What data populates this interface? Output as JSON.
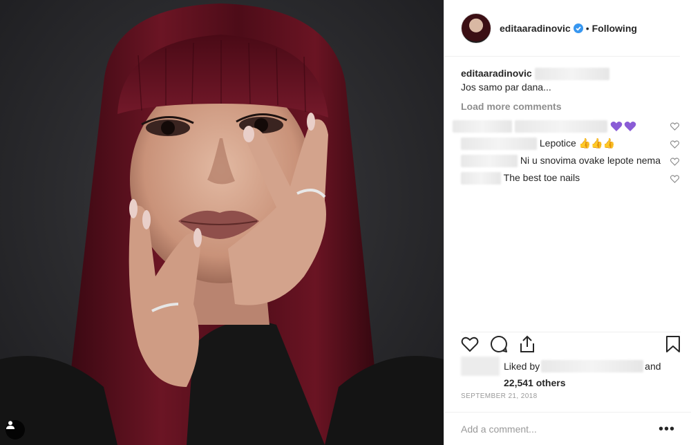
{
  "post": {
    "username": "editaaradinovic",
    "separator": "•",
    "follow_status": "Following"
  },
  "caption": {
    "username": "editaaradinovic",
    "text": "Jos samo par dana..."
  },
  "load_more": "Load more comments",
  "comments": [
    {
      "text": ""
    },
    {
      "text": "Lepotice 👍👍👍"
    },
    {
      "text": "Ni u snovima ovake lepote nema"
    },
    {
      "text": "The best toe nails"
    }
  ],
  "likes": {
    "prefix": "Liked by",
    "suffix": "and",
    "count": "22,541 others"
  },
  "date": "SEPTEMBER 21, 2018",
  "add_comment_placeholder": "Add a comment...",
  "more_options": "•••",
  "colors": {
    "accent_verified": "#3897f0",
    "heart_purple": "#8a5cd6",
    "hair": "#5a0f1c"
  },
  "icons": [
    "user-tag-icon",
    "verified-icon",
    "like-icon",
    "comment-icon",
    "share-icon",
    "save-icon",
    "comment-like-icon",
    "purple-heart-icon"
  ]
}
